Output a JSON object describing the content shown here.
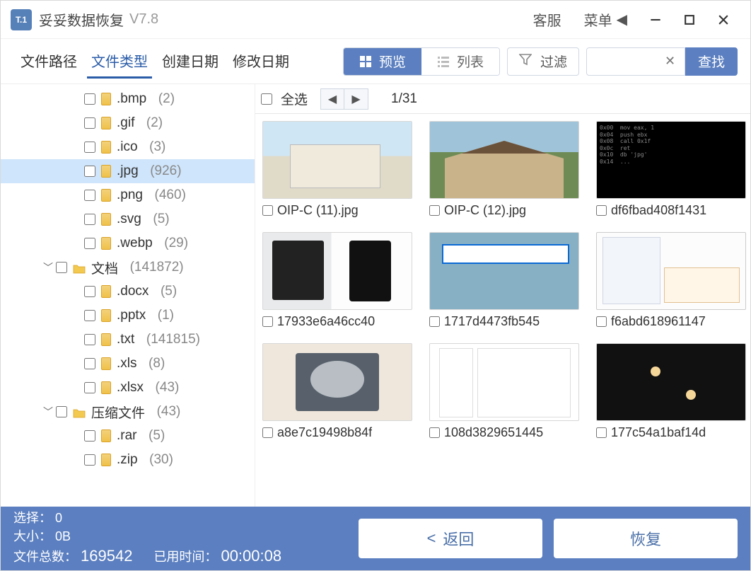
{
  "titlebar": {
    "logo_text": "T.1",
    "app_name": "妥妥数据恢复",
    "version": "V7.8",
    "support": "客服",
    "menu": "菜单"
  },
  "tabs": {
    "path": "文件路径",
    "type": "文件类型",
    "created": "创建日期",
    "modified": "修改日期",
    "active": "type"
  },
  "viewmode": {
    "preview": "预览",
    "list": "列表",
    "filter": "过滤",
    "search_btn": "查找"
  },
  "listheader": {
    "select_all": "全选",
    "page": "1/31"
  },
  "tree": [
    {
      "indent": 2,
      "kind": "file",
      "label": ".bmp",
      "count": "(2)"
    },
    {
      "indent": 2,
      "kind": "file",
      "label": ".gif",
      "count": "(2)"
    },
    {
      "indent": 2,
      "kind": "file",
      "label": ".ico",
      "count": "(3)"
    },
    {
      "indent": 2,
      "kind": "file",
      "label": ".jpg",
      "count": "(926)",
      "selected": true
    },
    {
      "indent": 2,
      "kind": "file",
      "label": ".png",
      "count": "(460)"
    },
    {
      "indent": 2,
      "kind": "file",
      "label": ".svg",
      "count": "(5)"
    },
    {
      "indent": 2,
      "kind": "file",
      "label": ".webp",
      "count": "(29)"
    },
    {
      "indent": 1,
      "kind": "folder",
      "caret": true,
      "label": "文档",
      "count": "(141872)"
    },
    {
      "indent": 2,
      "kind": "file",
      "label": ".docx",
      "count": "(5)"
    },
    {
      "indent": 2,
      "kind": "file",
      "label": ".pptx",
      "count": "(1)"
    },
    {
      "indent": 2,
      "kind": "file",
      "label": ".txt",
      "count": "(141815)"
    },
    {
      "indent": 2,
      "kind": "file",
      "label": ".xls",
      "count": "(8)"
    },
    {
      "indent": 2,
      "kind": "file",
      "label": ".xlsx",
      "count": "(43)"
    },
    {
      "indent": 1,
      "kind": "folder",
      "caret": true,
      "label": "压缩文件",
      "count": "(43)"
    },
    {
      "indent": 2,
      "kind": "file",
      "label": ".rar",
      "count": "(5)"
    },
    {
      "indent": 2,
      "kind": "file",
      "label": ".zip",
      "count": "(30)"
    }
  ],
  "items": [
    {
      "name": "OIP-C (11).jpg",
      "thumb": "th-house1"
    },
    {
      "name": "OIP-C (12).jpg",
      "thumb": "th-house2"
    },
    {
      "name": "df6fbad408f1431",
      "thumb": "th-code"
    },
    {
      "name": "17933e6a46cc40",
      "thumb": "th-laptop-hdd"
    },
    {
      "name": "1717d4473fb545",
      "thumb": "th-blue"
    },
    {
      "name": "f6abd618961147",
      "thumb": "th-ui"
    },
    {
      "name": "a8e7c19498b84f",
      "thumb": "th-hdd"
    },
    {
      "name": "108d3829651445",
      "thumb": "th-tree"
    },
    {
      "name": "177c54a1baf14d",
      "thumb": "th-dark"
    }
  ],
  "footer": {
    "sel_label": "选择：",
    "sel_value": "0",
    "size_label": "大小：",
    "size_value": "0B",
    "total_label": "文件总数：",
    "total_value": "169542",
    "elapsed_label": "已用时间：",
    "elapsed_value": "00:00:08",
    "back": "返回",
    "recover": "恢复"
  }
}
